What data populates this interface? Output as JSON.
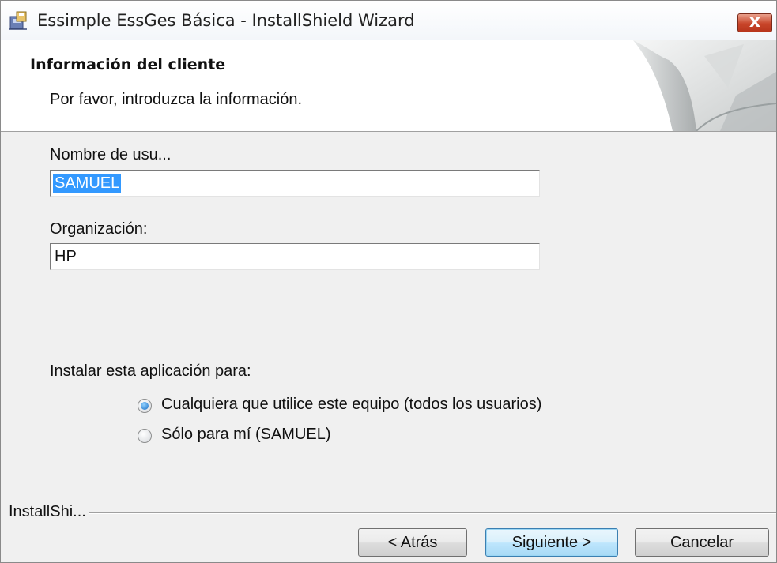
{
  "window": {
    "title": "Essimple EssGes Básica - InstallShield Wizard",
    "close_label": "x"
  },
  "banner": {
    "title": "Información del cliente",
    "subtitle": "Por favor, introduzca la información."
  },
  "form": {
    "username": {
      "label": "Nombre de usu...",
      "value": "SAMUEL"
    },
    "organization": {
      "label": "Organización:",
      "value": "HP"
    },
    "install_for": {
      "label": "Instalar esta aplicación para:",
      "options": [
        {
          "label": "Cualquiera que utilice este equipo (todos los usuarios)",
          "selected": true
        },
        {
          "label": "Sólo para mí (SAMUEL)",
          "selected": false
        }
      ]
    }
  },
  "footer": {
    "brand": "InstallShi...",
    "back_label": "< Atrás",
    "next_label": "Siguiente >",
    "cancel_label": "Cancelar"
  },
  "colors": {
    "selection": "#3399ff",
    "dialog_background": "#f0f0f0",
    "close_button": "#c8452a",
    "radio_dot": "#1a6fc4"
  }
}
